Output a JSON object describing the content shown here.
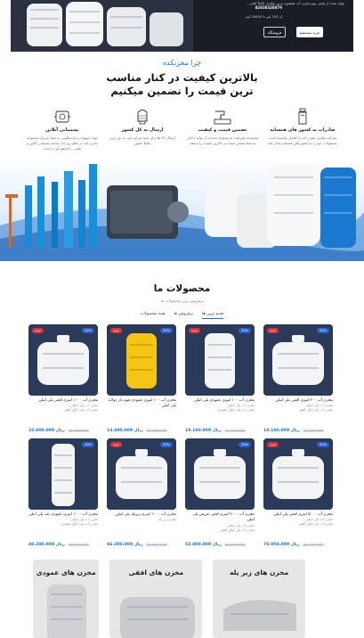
{
  "hero": {
    "line1": "تولید شده از پلیمر نوع مخزن آب همچون ترینِ تولیدی کاملاً اتیلن...",
    "line2": "مخزن های ۵۰ تا ۳ هزار لیتری...",
    "phone": "02636320874",
    "sub": "از 100 لیتر تا 10000 لیتر",
    "buy_label": "خرید مستقیم",
    "store_label": "فروشگاه"
  },
  "why": {
    "kicker": "چرا مخزنکده",
    "title_line1": "بالاترین کیفیت در کنار مناسب",
    "title_line2": "ترین قیمت را تضمین میکنیم",
    "features": [
      {
        "icon": "export-bottle-icon",
        "title": "صادرات به کشور های همسایه",
        "desc": "شرکت تولیدی مخزن کده با افتخار توانسته است محصولات خود را به کشور های همسایه صادر کند"
      },
      {
        "icon": "quality-tap-icon",
        "title": "تضمین قیمت و کیفیت",
        "desc": "مجموعه مخزنکده به پشتوانه خدمات از تولید داخلی به شما تضمین قیمت و بالاترین کیفیت را میدهد."
      },
      {
        "icon": "shipping-icon",
        "title": "ارسال به کل کشور",
        "desc": "ارسال 45 ها برای شما تمرکز حتی به دور ترین نقاط کشور"
      },
      {
        "icon": "support-icon",
        "title": "پشتیبانی آنلاین",
        "desc": "جهت سهولت و پاسخگویی به شما عزیزان مجموعه مخزن کده در تمام روز 24 ساعته پشتیبانی آنلاین و تلفنی را فراهم آورده است"
      }
    ]
  },
  "products": {
    "title": "محصولات ما",
    "subtitle": "پرفروش ترین محصولات ما",
    "tabs": [
      "جدید ترین ها",
      "پرفروش ها",
      "همه محصولات"
    ],
    "items": [
      {
        "name": "مخزن آب ۲۰۰ لیتری افقی پلی اتیلن",
        "meta1": "مخزن آب پلی اتیلنی",
        "meta2": "مخزن آب پلی اتیلن افقی",
        "price": "10.160.000",
        "old": "11.700.000",
        "off": "20%",
        "new": "جدید",
        "tank": "white-h"
      },
      {
        "name": "مخزن آب ۱۰۰ لیتری عمودی پلی اتیلن",
        "meta1": "مخزن آب پلی اتیلنی",
        "meta2": "مخزن آب پلی اتیلن عمودی",
        "price": "10.160.000",
        "old": "13.700.000",
        "off": "20%",
        "new": "جدید",
        "tank": "white-v"
      },
      {
        "name": "مخزن آب ۱۰۰ لیتری عمودی فوم دار دولایه پلی اتیلن",
        "meta1": "",
        "meta2": "",
        "price": "14.400.000",
        "old": "16.000.000",
        "off": "20%",
        "new": "جدید",
        "tank": "yellow"
      },
      {
        "name": "مخزن آب ۱۰۰۰ لیتری افقی پلی اتیلن",
        "meta1": "مخزن آب پلی اتیلنی",
        "meta2": "مخزن آب پلی اتیلن افقی",
        "price": "32.800.000",
        "old": "40.000.000",
        "off": "20%",
        "new": "جدید",
        "tank": "white-h2"
      },
      {
        "name": "مخزن آب ۵۰۰۰ لیتری افقی پلی اتیلن",
        "meta1": "مخزن آب پلی اتیلنی",
        "meta2": "مخزن آب پلی اتیلن افقی",
        "price": "76.050.000",
        "old": "84.500.000",
        "off": "20%",
        "new": "جدید",
        "tank": "white-h"
      },
      {
        "name": "مخزن آب ۳۰۰۰ لیتری افقی عریض پلی اتیلن",
        "meta1": "مخزن آب پلی اتیلنی",
        "meta2": "مخزن آب پلی اتیلن افقی",
        "price": "52.800.000",
        "old": "66.000.000",
        "off": "20%",
        "new": "",
        "tank": "white-h2"
      },
      {
        "name": "مخزن آب ۱۰۰۰ لیتری زیرپله پلی اتیلن",
        "meta1": "مخزن زیر پله",
        "meta2": "",
        "price": "66.200.000",
        "old": "81.000.000",
        "off": "20%",
        "new": "جدید",
        "tank": "white-h"
      },
      {
        "name": "مخزن آب ۱۰۰۰ لیتری عمودی بلند پلی اتیلن",
        "meta1": "مخزن آب پلی اتیلنی",
        "meta2": "مخزن آب پلی اتیلن عمودی",
        "price": "40.280.000",
        "old": "47.000.000",
        "off": "20%",
        "new": "",
        "tank": "white-tall"
      }
    ],
    "currency": "ریال",
    "brand_on_tank": "مخزنکده"
  },
  "categories": [
    {
      "title": "مخزن های عمودی"
    },
    {
      "title": "مخزن های افقی"
    },
    {
      "title": "مخزن های زیر پله"
    }
  ],
  "colors": {
    "accent": "#1e74d4",
    "card_bg": "#2c3a59",
    "badge_off": "#2a5fd0",
    "badge_new": "#d8343a",
    "hero_bg": "#1a1d24"
  }
}
